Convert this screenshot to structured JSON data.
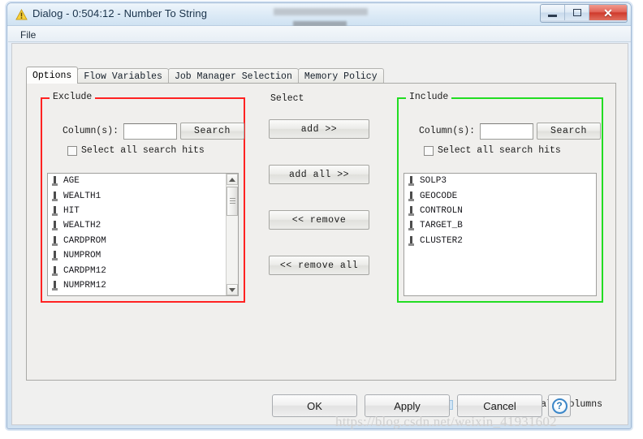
{
  "window": {
    "title": "Dialog - 0:504:12 - Number To String",
    "icon": "warning-triangle-icon",
    "minimize_label": "",
    "maximize_label": "",
    "close_label": "✕"
  },
  "menubar": {
    "items": [
      {
        "label": "File"
      }
    ]
  },
  "tabs": [
    {
      "label": "Options",
      "active": true
    },
    {
      "label": "Flow Variables",
      "active": false
    },
    {
      "label": "Job Manager Selection",
      "active": false
    },
    {
      "label": "Memory Policy",
      "active": false
    }
  ],
  "exclude_panel": {
    "title": "Exclude",
    "border_color": "#ff2222",
    "search_label": "Column(s):",
    "search_value": "",
    "search_placeholder": "",
    "search_button": "Search",
    "select_all_hits_label": "Select all search hits",
    "select_all_hits_checked": false,
    "items": [
      "AGE",
      "WEALTH1",
      "HIT",
      "WEALTH2",
      "CARDPROM",
      "NUMPROM",
      "CARDPM12",
      "NUMPRM12"
    ]
  },
  "select_panel": {
    "title": "Select",
    "buttons": [
      {
        "label": "add >>"
      },
      {
        "label": "add all >>"
      },
      {
        "label": "<< remove"
      },
      {
        "label": "<< remove all"
      }
    ]
  },
  "include_panel": {
    "title": "Include",
    "border_color": "#22dd22",
    "search_label": "Column(s):",
    "search_value": "",
    "search_placeholder": "",
    "search_button": "Search",
    "select_all_hits_label": "Select all search hits",
    "select_all_hits_checked": false,
    "items": [
      "SOLP3",
      "GEOCODE",
      "CONTROLN",
      "TARGET_B",
      "CLUSTER2"
    ]
  },
  "always_include": {
    "label": "Always include all columns",
    "checked": false
  },
  "footer": {
    "ok_label": "OK",
    "apply_label": "Apply",
    "cancel_label": "Cancel",
    "help_label": "?"
  },
  "watermark": {
    "text": "https://blog.csdn.net/weixin_41931602"
  }
}
